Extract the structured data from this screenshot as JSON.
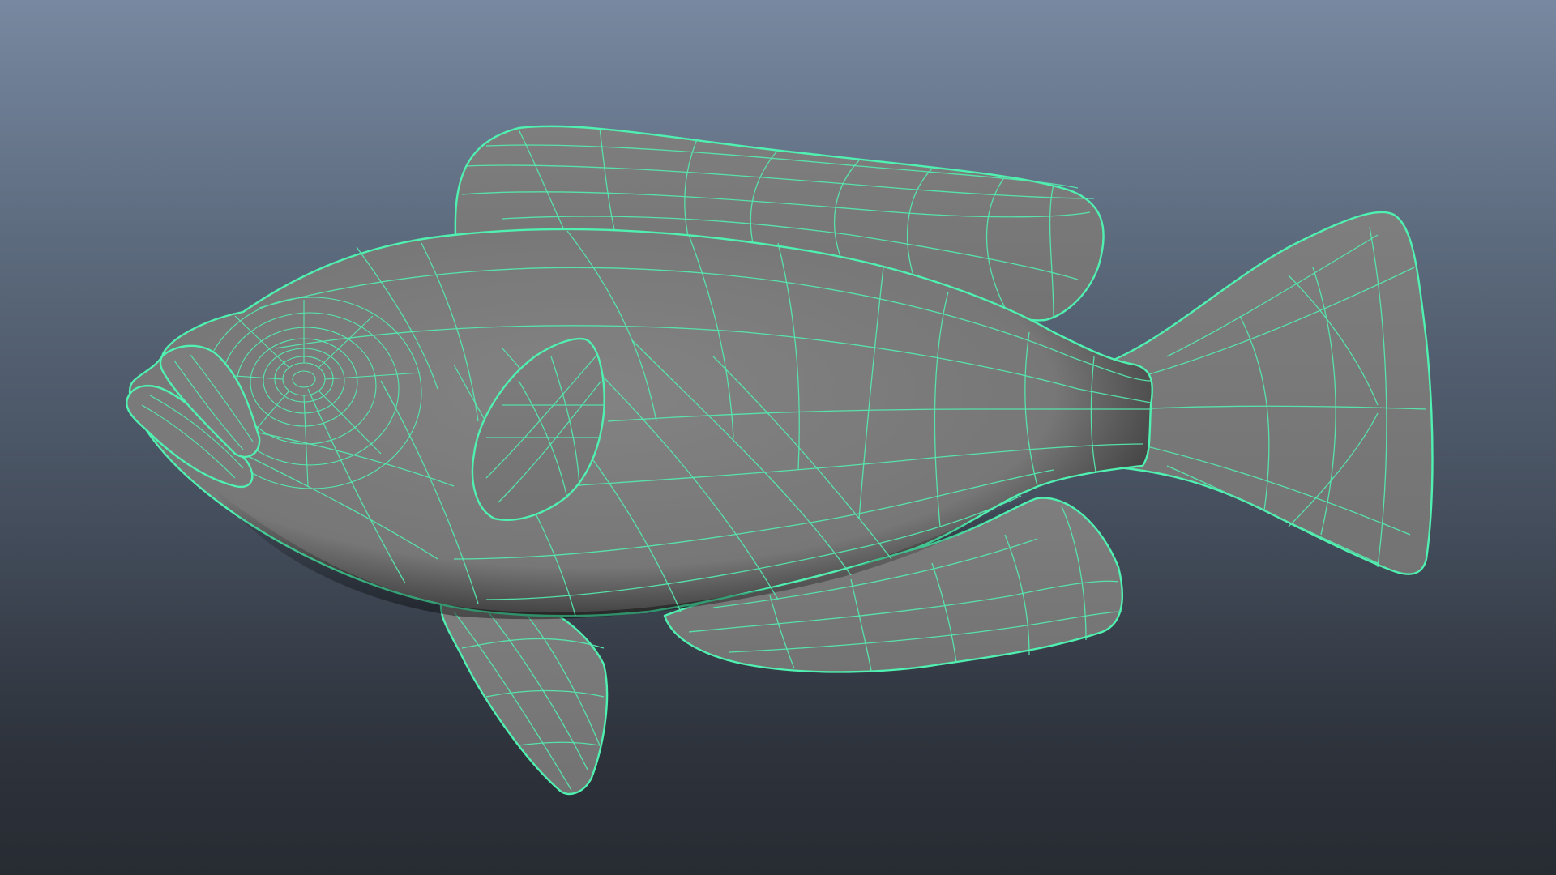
{
  "viewport": {
    "background_top": "#7788a0",
    "background_bottom": "#272b32"
  },
  "model": {
    "object": "fish",
    "display_mode": "wireframe-on-shaded",
    "surface_color": "#7b7b7b",
    "wireframe_color": "#55e8ae"
  }
}
